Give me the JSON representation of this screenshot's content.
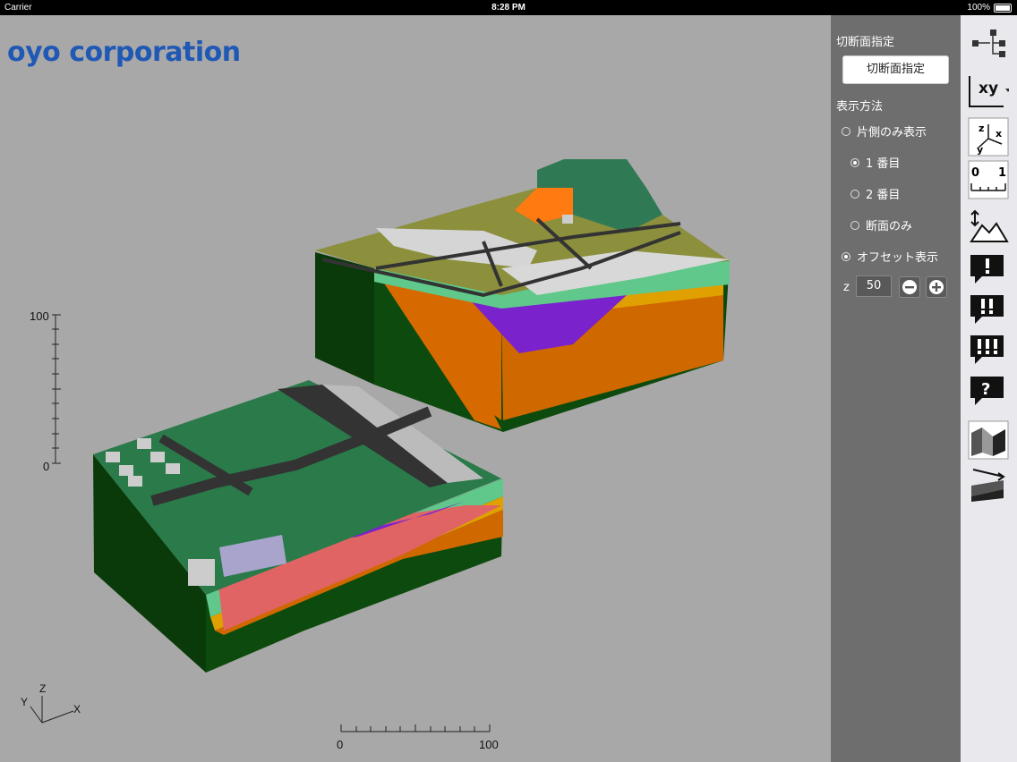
{
  "status": {
    "carrier": "Carrier",
    "time": "8:28 PM",
    "battery": "100%"
  },
  "logo": "oyo corporation",
  "scale": {
    "vertical_max": "100",
    "vertical_min": "0",
    "horizontal_min": "0",
    "horizontal_max": "100"
  },
  "axes": {
    "x": "X",
    "y": "Y",
    "z": "Z"
  },
  "panel": {
    "cut_title": "切断面指定",
    "cut_button": "切断面指定",
    "display_title": "表示方法",
    "options": [
      {
        "label": "片側のみ表示",
        "selected": false
      },
      {
        "label": "1 番目",
        "selected": true
      },
      {
        "label": "2 番目",
        "selected": false
      },
      {
        "label": "断面のみ",
        "selected": false
      },
      {
        "label": "オフセット表示",
        "selected": true
      }
    ],
    "z_label": "z",
    "z_value": "50"
  },
  "toolbar": {
    "tools": [
      "hierarchy-icon",
      "xy-plane-icon",
      "axes-icon",
      "ruler-icon",
      "terrain-icon",
      "alert-1-icon",
      "alert-2-icon",
      "alert-3-icon",
      "question-icon",
      "cross-section-icon",
      "slice-icon"
    ],
    "xy_label": "xy"
  }
}
